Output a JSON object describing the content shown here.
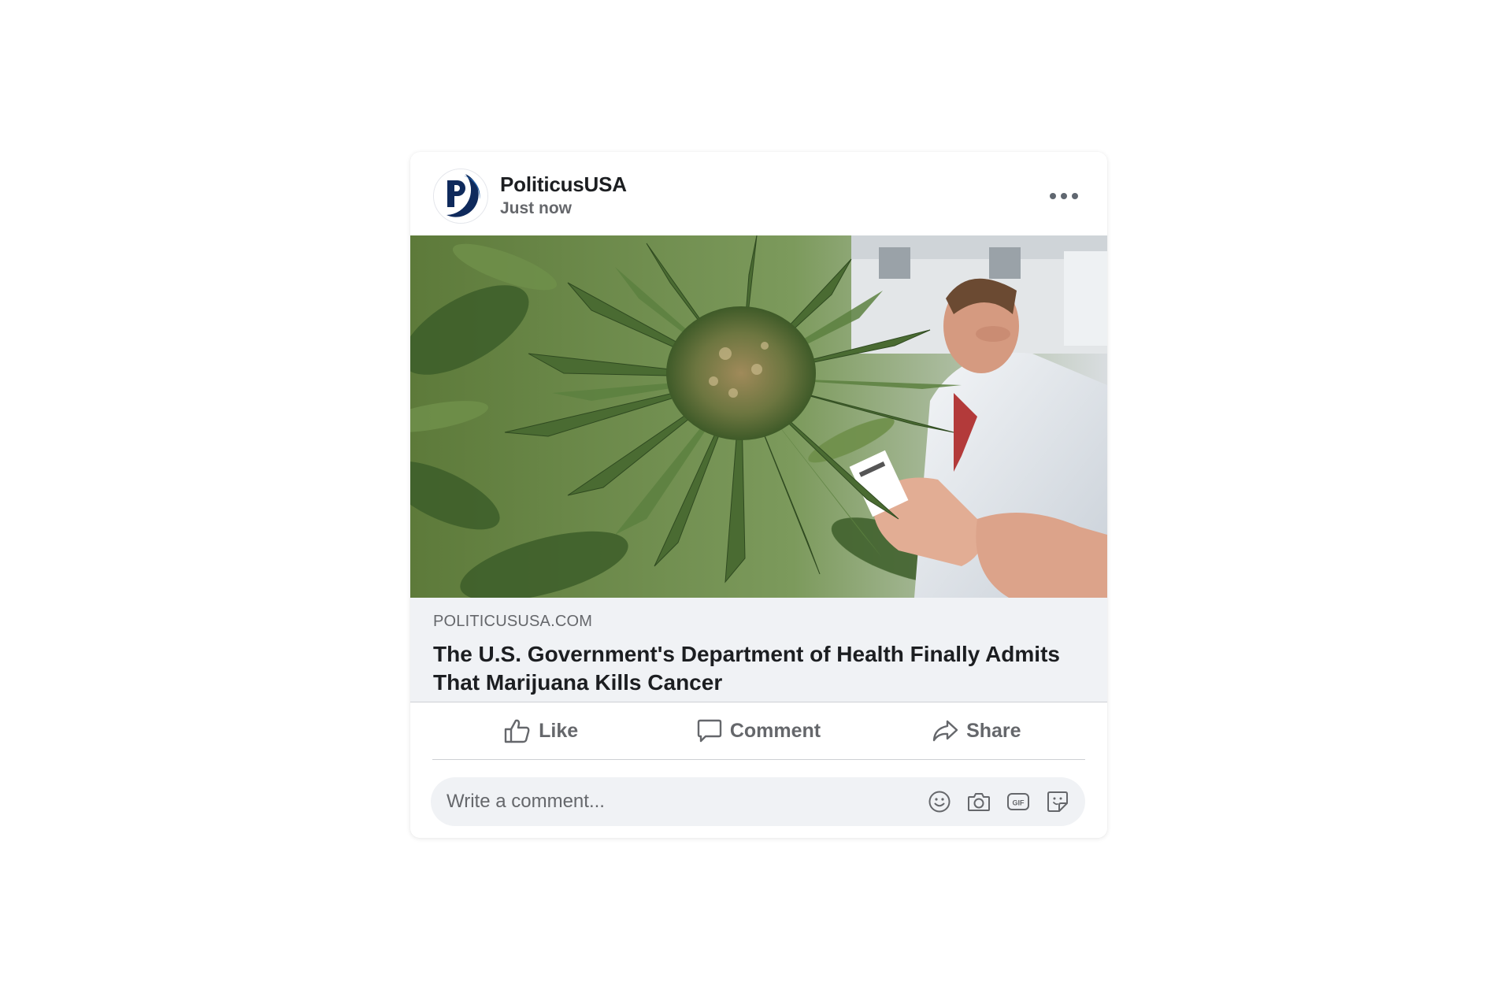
{
  "post": {
    "author": "PoliticusUSA",
    "timestamp": "Just now",
    "avatar_letter": "P",
    "image_icon": "cannabis-plant-photo",
    "link": {
      "domain": "POLITICUSUSA.COM",
      "title": "The U.S. Government's Department of Health Finally Admits That Marijuana Kills Cancer"
    },
    "actions": {
      "like": "Like",
      "comment": "Comment",
      "share": "Share"
    },
    "comment_box": {
      "placeholder": "Write a comment..."
    }
  },
  "icons": {
    "more": "more-options-icon",
    "like": "thumbs-up-icon",
    "comment": "comment-bubble-icon",
    "share": "share-arrow-icon",
    "emoji": "emoji-icon",
    "camera": "camera-icon",
    "gif": "gif-icon",
    "sticker": "sticker-icon"
  },
  "colors": {
    "brand_navy": "#0f2a5c",
    "brand_blue": "#1f5fa8",
    "secondary_text": "#65676b",
    "primary_text": "#1c1e21",
    "surface": "#f0f2f5"
  }
}
